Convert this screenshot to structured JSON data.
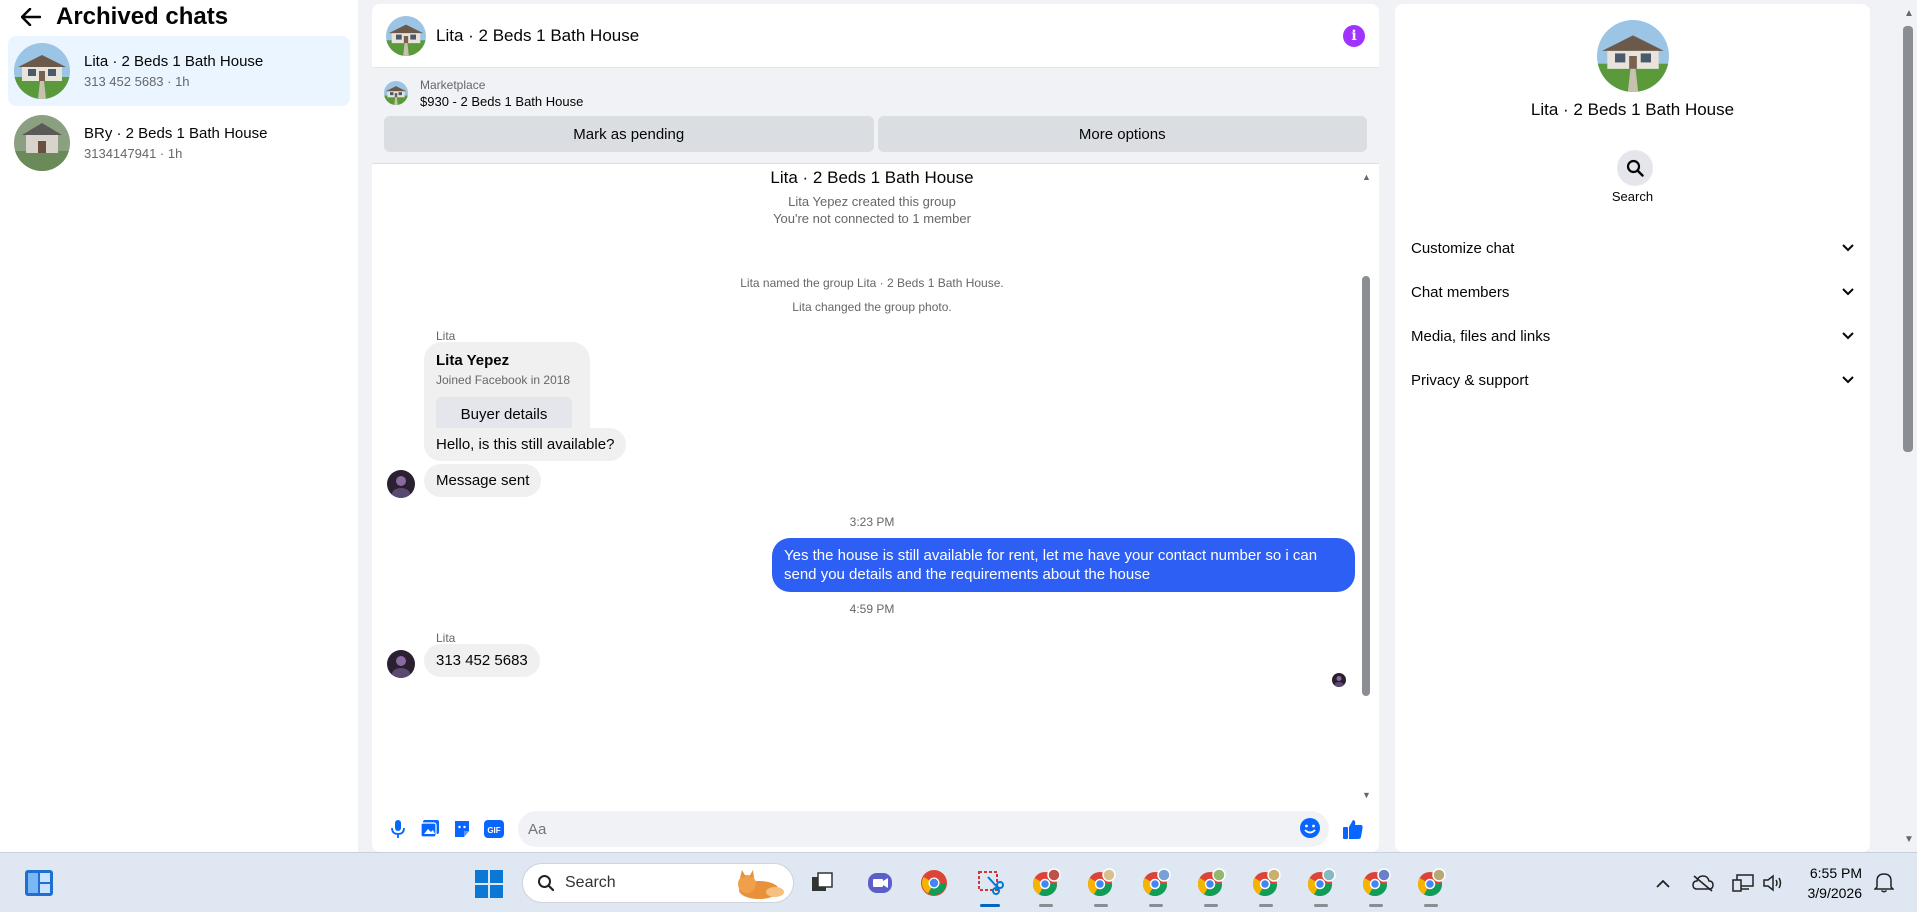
{
  "sidebar": {
    "title": "Archived chats",
    "chats": [
      {
        "name": "Lita · 2 Beds 1 Bath House",
        "sub": "313 452 5683 · 1h"
      },
      {
        "name": "BRy · 2 Beds 1 Bath House",
        "sub": "3134147941 · 1h"
      }
    ]
  },
  "chat": {
    "title": "Lita · 2 Beds 1 Bath House",
    "marketplace": {
      "label": "Marketplace",
      "listing": "$930 - 2 Beds 1 Bath House",
      "mark_pending": "Mark as pending",
      "more_options": "More options"
    },
    "group": {
      "title": "Lita · 2 Beds 1 Bath House",
      "created": "Lita Yepez created this group",
      "not_connected": "You're not connected to 1 member"
    },
    "system": {
      "named": "Lita named the group Lita · 2 Beds 1 Bath House.",
      "photo": "Lita changed the group photo."
    },
    "sender_1": "Lita",
    "card": {
      "name": "Lita Yepez",
      "joined": "Joined Facebook in 2018",
      "button": "Buyer details"
    },
    "msg_1": "Hello, is this still available?",
    "msg_2": "Message sent",
    "time_1": "3:23 PM",
    "msg_out": "Yes the house is still available for rent, let me have your contact number so i can send you details and the requirements about the house",
    "time_2": "4:59 PM",
    "sender_2": "Lita",
    "msg_3": "313 452 5683",
    "composer": {
      "placeholder": "Aa",
      "gif": "GIF"
    }
  },
  "details": {
    "name": "Lita · 2 Beds 1 Bath House",
    "search_label": "Search",
    "sections": [
      "Customize chat",
      "Chat members",
      "Media, files and links",
      "Privacy & support"
    ]
  },
  "taskbar": {
    "search_placeholder": "Search",
    "time": "6:55 PM",
    "date": "3/9/2026"
  },
  "colors": {
    "accent_blue": "#2d5ff5",
    "info_purple": "#a033ff",
    "active_chat": "#ebf5ff"
  }
}
